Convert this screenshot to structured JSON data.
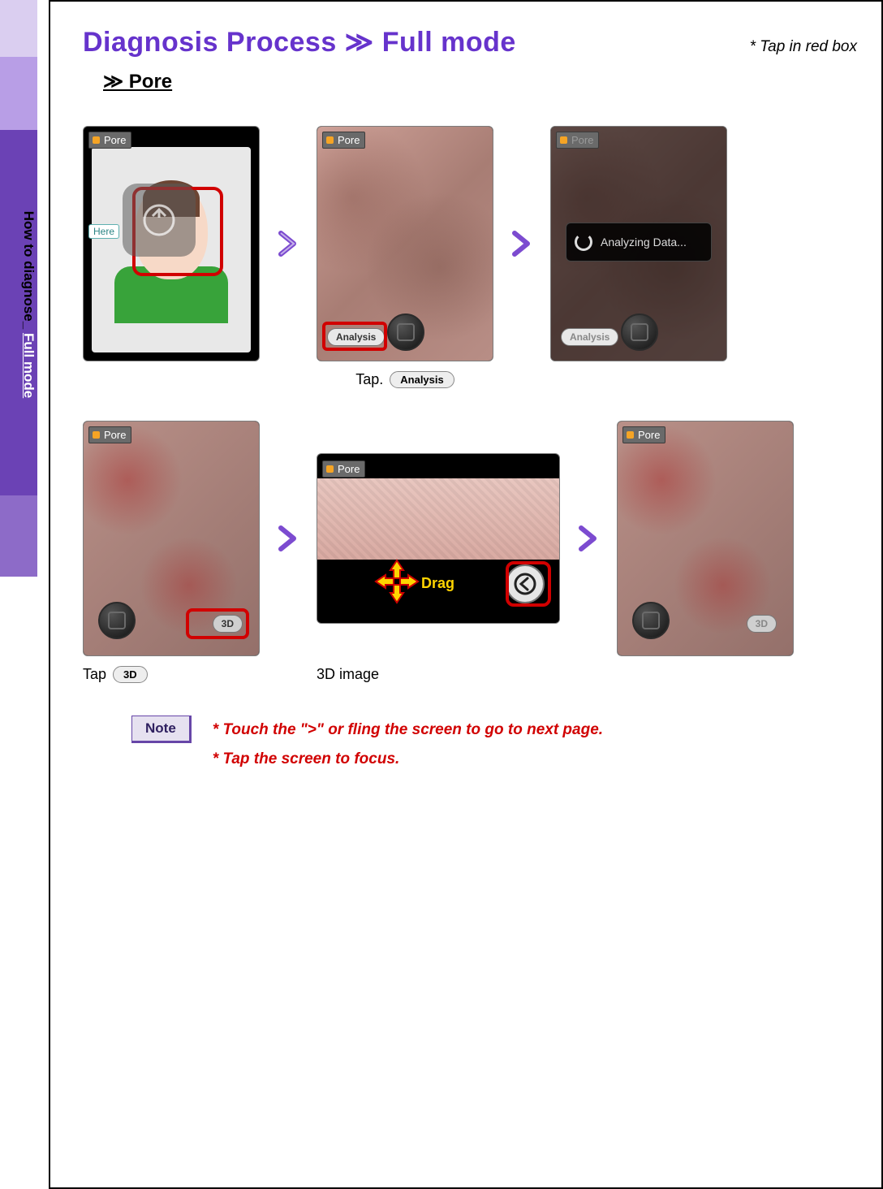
{
  "sidebar": {
    "label_prefix": "How to diagnose_ ",
    "label_suffix": "Full mode"
  },
  "header": {
    "title": "Diagnosis Process ≫ Full mode",
    "hint": "* Tap in red box"
  },
  "subheader": "≫  Pore",
  "tags": {
    "pore": "Pore",
    "here": "Here",
    "analysis_btn": "Analysis",
    "threeD_btn": "3D",
    "analyzing": "Analyzing Data...",
    "drag": "Drag"
  },
  "captions": {
    "tap_analysis_prefix": "Tap.",
    "tap_analysis_pill": "Analysis",
    "tap_3d_prefix": "Tap",
    "tap_3d_pill": "3D",
    "threeD_image": "3D image"
  },
  "note": {
    "badge": "Note",
    "line1": "* Touch the \">\" or fling the screen to go to next page.",
    "line2": "* Tap the screen to focus."
  }
}
